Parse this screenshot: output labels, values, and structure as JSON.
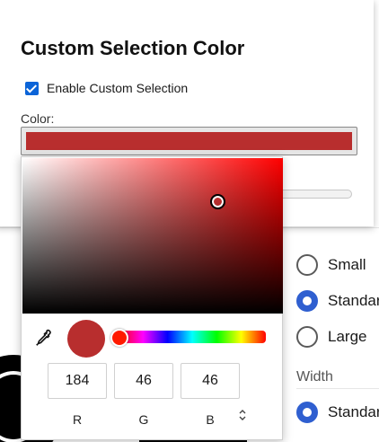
{
  "background": {
    "radio_options_top": [
      {
        "label": "Small",
        "checked": false
      },
      {
        "label": "Standard",
        "checked": true
      },
      {
        "label": "Large",
        "checked": false
      }
    ],
    "width_section_label": "Width",
    "radio_options_width": [
      {
        "label": "Standard",
        "checked": true
      }
    ]
  },
  "dialog": {
    "title": "Custom Selection Color",
    "enable_checkbox_label": "Enable Custom Selection",
    "enable_checked": true,
    "color_label": "Color:",
    "selected_color": "#b82e2e"
  },
  "picker": {
    "hue_color": "#ff0000",
    "saturation": 0.75,
    "brightness": 0.72,
    "hue_position": 0.0,
    "preview_color": "#b82e2e",
    "channels": [
      {
        "label": "R",
        "value": "184"
      },
      {
        "label": "G",
        "value": "46"
      },
      {
        "label": "B",
        "value": "46"
      }
    ],
    "mode_toggle_icon": "up-down-chevron-icon"
  }
}
